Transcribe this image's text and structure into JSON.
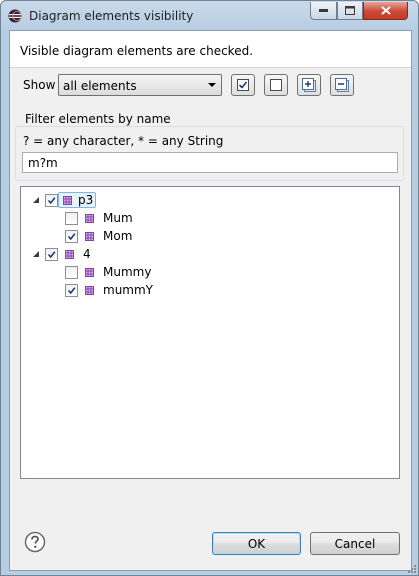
{
  "window": {
    "title": "Diagram elements visibility"
  },
  "message": "Visible diagram elements are checked.",
  "show": {
    "label": "Show",
    "selected": "all elements"
  },
  "toolbar": [
    {
      "name": "check-all-button",
      "icon": "checkbox-checked-icon"
    },
    {
      "name": "uncheck-all-button",
      "icon": "checkbox-empty-icon"
    },
    {
      "name": "expand-all-button",
      "icon": "plus-box-icon"
    },
    {
      "name": "collapse-all-button",
      "icon": "minus-box-icon"
    }
  ],
  "filter": {
    "title": "Filter elements by name",
    "hint": "? = any character, * = any String",
    "value": "m?m"
  },
  "tree": [
    {
      "label": "p3",
      "level": 0,
      "expanded": true,
      "checked": true,
      "selected": true
    },
    {
      "label": "Mum",
      "level": 1,
      "checked": false
    },
    {
      "label": "Mom",
      "level": 1,
      "checked": true
    },
    {
      "label": "4",
      "level": 0,
      "expanded": true,
      "checked": true
    },
    {
      "label": "Mummy",
      "level": 1,
      "checked": false
    },
    {
      "label": "mummY",
      "level": 1,
      "checked": true
    }
  ],
  "buttons": {
    "ok": "OK",
    "cancel": "Cancel"
  },
  "colors": {
    "element_icon": "#8a3fb0",
    "selection_border": "#7eb4ea"
  }
}
